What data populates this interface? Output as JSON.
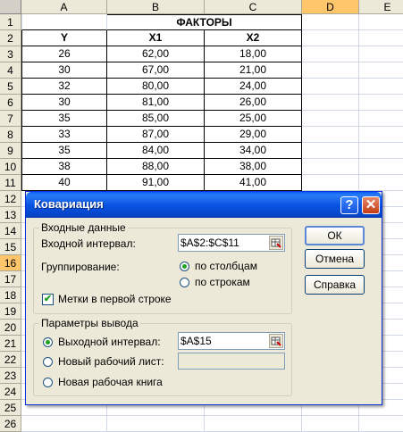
{
  "sheet": {
    "columns": [
      "A",
      "B",
      "C",
      "D",
      "E"
    ],
    "rows": [
      "1",
      "2",
      "3",
      "4",
      "5",
      "6",
      "7",
      "8",
      "9",
      "10",
      "11",
      "12",
      "13",
      "14",
      "15",
      "16",
      "17",
      "18",
      "19",
      "20",
      "21",
      "22",
      "23",
      "24",
      "25",
      "26"
    ],
    "factors_header": "ФАКТОРЫ",
    "headers": [
      "Y",
      "X1",
      "X2"
    ],
    "data": [
      [
        "26",
        "62,00",
        "18,00"
      ],
      [
        "30",
        "67,00",
        "21,00"
      ],
      [
        "32",
        "80,00",
        "24,00"
      ],
      [
        "30",
        "81,00",
        "26,00"
      ],
      [
        "35",
        "85,00",
        "25,00"
      ],
      [
        "33",
        "87,00",
        "29,00"
      ],
      [
        "35",
        "84,00",
        "34,00"
      ],
      [
        "38",
        "88,00",
        "38,00"
      ],
      [
        "40",
        "91,00",
        "41,00"
      ]
    ],
    "selected_row": "16",
    "selected_column": "D",
    "highlight_color": "#ffc56b"
  },
  "dialog": {
    "title": "Ковариация",
    "help_glyph": "?",
    "close_glyph": "✕",
    "input_group_label": "Входные данные",
    "input_range_label": "Входной интервал:",
    "input_range_value": "$A$2:$C$11",
    "grouping_label": "Группирование:",
    "by_columns_label": "по столбцам",
    "by_rows_label": "по строкам",
    "labels_first_row_label": "Метки в первой строке",
    "labels_first_row_checked": "✔",
    "output_group_label": "Параметры вывода",
    "output_range_label": "Выходной интервал:",
    "output_range_value": "$A$15",
    "new_sheet_label": "Новый рабочий лист:",
    "new_book_label": "Новая рабочая книга",
    "ok_label": "ОК",
    "cancel_label": "Отмена",
    "help_label": "Справка",
    "title_bar_color": "#0b54e3"
  }
}
